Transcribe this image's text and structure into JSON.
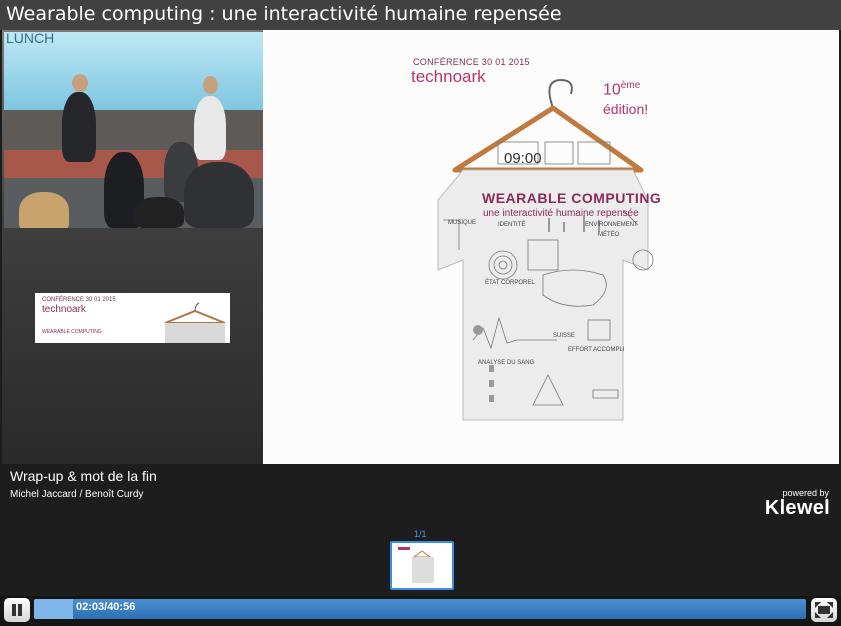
{
  "window": {
    "title": "Wearable computing : une interactivité humaine repensée"
  },
  "video": {
    "projection_text": "LUNCH"
  },
  "slide_thumb_left": {
    "conf": "CONFÉRENCE 30 01 2015",
    "brand": "technoark",
    "subtitle": "WEARABLE COMPUTING"
  },
  "slide": {
    "conf": "CONFÉRENCE 30 01 2015",
    "brand": "technoark",
    "edition_num": "10",
    "edition_sup": "ème",
    "edition_word": "édition!",
    "time": "09:00",
    "title": "WEARABLE COMPUTING",
    "subtitle": "une interactivité humaine repensée",
    "labels": {
      "identite": "IDENTITÉ",
      "environnement": "ENVIRONNEMENT",
      "meteo": "MÉTÉO",
      "musique": "MUSIQUE",
      "etat": "ÉTAT CORPOREL",
      "suisse": "SUISSE",
      "effort": "EFFORT ACCOMPLI",
      "analyse": "ANALYSE DU SANG"
    }
  },
  "info": {
    "title": "Wrap-up & mot de la fin",
    "speakers": "Michel Jaccard / Benoît Curdy"
  },
  "branding": {
    "powered_by": "powered by",
    "logo": "Klewel"
  },
  "thumbnails": {
    "label": "1/1"
  },
  "player": {
    "time": "02:03/40:56",
    "progress": 0.05,
    "accent": "#2d6fb4"
  }
}
